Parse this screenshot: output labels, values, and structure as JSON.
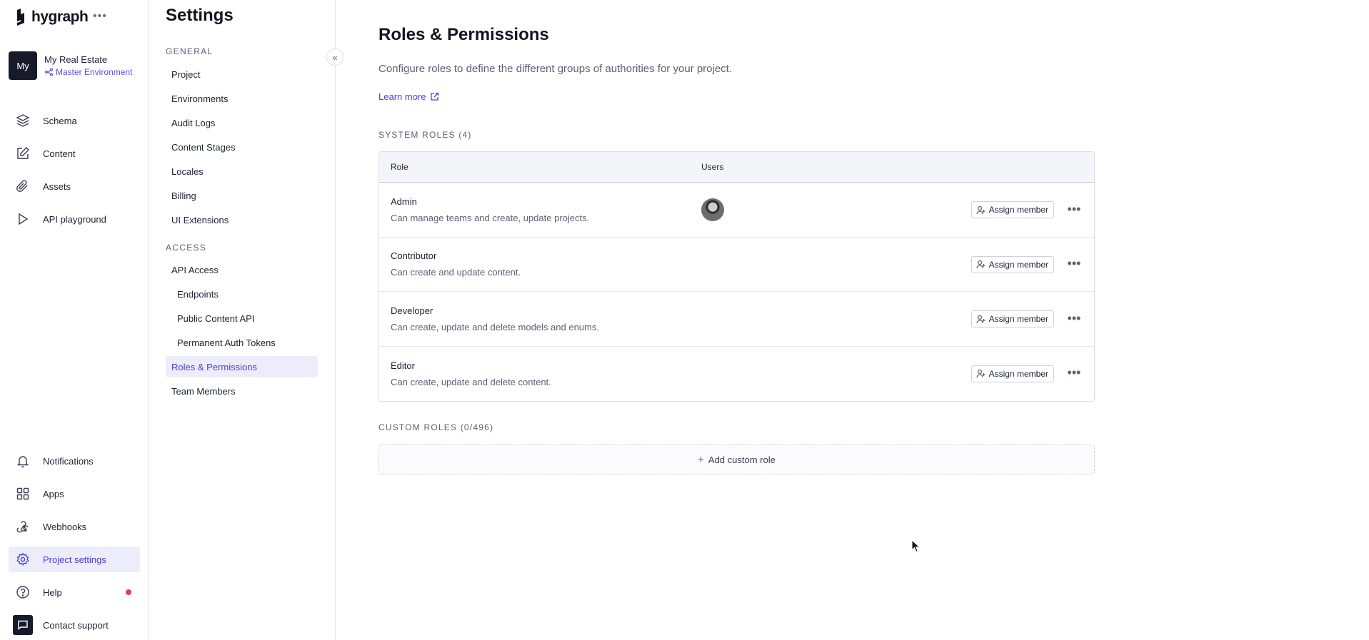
{
  "brand": {
    "name": "hygraph",
    "menu_icon": "more-horizontal-icon"
  },
  "project": {
    "avatar_text": "My",
    "name": "My Real Estate",
    "environment": "Master Environment"
  },
  "nav_top": [
    {
      "label": "Schema",
      "icon": "layers-icon"
    },
    {
      "label": "Content",
      "icon": "edit-icon"
    },
    {
      "label": "Assets",
      "icon": "paperclip-icon"
    },
    {
      "label": "API playground",
      "icon": "play-icon"
    }
  ],
  "nav_bottom": [
    {
      "label": "Notifications",
      "icon": "bell-icon"
    },
    {
      "label": "Apps",
      "icon": "apps-icon"
    },
    {
      "label": "Webhooks",
      "icon": "webhook-icon"
    },
    {
      "label": "Project settings",
      "icon": "gear-icon",
      "active": true
    },
    {
      "label": "Help",
      "icon": "help-icon",
      "badge": "red-dot"
    },
    {
      "label": "Contact support",
      "icon": "chat-icon"
    }
  ],
  "settings": {
    "title": "Settings",
    "general_label": "GENERAL",
    "general_items": [
      "Project",
      "Environments",
      "Audit Logs",
      "Content Stages",
      "Locales",
      "Billing",
      "UI Extensions"
    ],
    "access_label": "ACCESS",
    "access_items": [
      "API Access"
    ],
    "api_sub_items": [
      "Endpoints",
      "Public Content API",
      "Permanent Auth Tokens"
    ],
    "access_items_after": [
      "Roles & Permissions",
      "Team Members"
    ],
    "active_item": "Roles & Permissions"
  },
  "main": {
    "title": "Roles & Permissions",
    "description": "Configure roles to define the different groups of authorities for your project.",
    "learn_more": "Learn more",
    "system_roles_label": "SYSTEM ROLES (4)",
    "table_headers": {
      "role": "Role",
      "users": "Users"
    },
    "roles": [
      {
        "name": "Admin",
        "description": "Can manage teams and create, update projects.",
        "has_user_avatar": true
      },
      {
        "name": "Contributor",
        "description": "Can create and update content.",
        "has_user_avatar": false
      },
      {
        "name": "Developer",
        "description": "Can create, update and delete models and enums.",
        "has_user_avatar": false
      },
      {
        "name": "Editor",
        "description": "Can create, update and delete content.",
        "has_user_avatar": false
      }
    ],
    "assign_label": "Assign member",
    "custom_roles_label": "CUSTOM ROLES (0/496)",
    "add_custom_role": "Add custom role"
  },
  "colors": {
    "accent": "#4a3fd6",
    "active_bg": "#ececfb",
    "dark": "#171a2b",
    "badge": "#e8386b"
  }
}
